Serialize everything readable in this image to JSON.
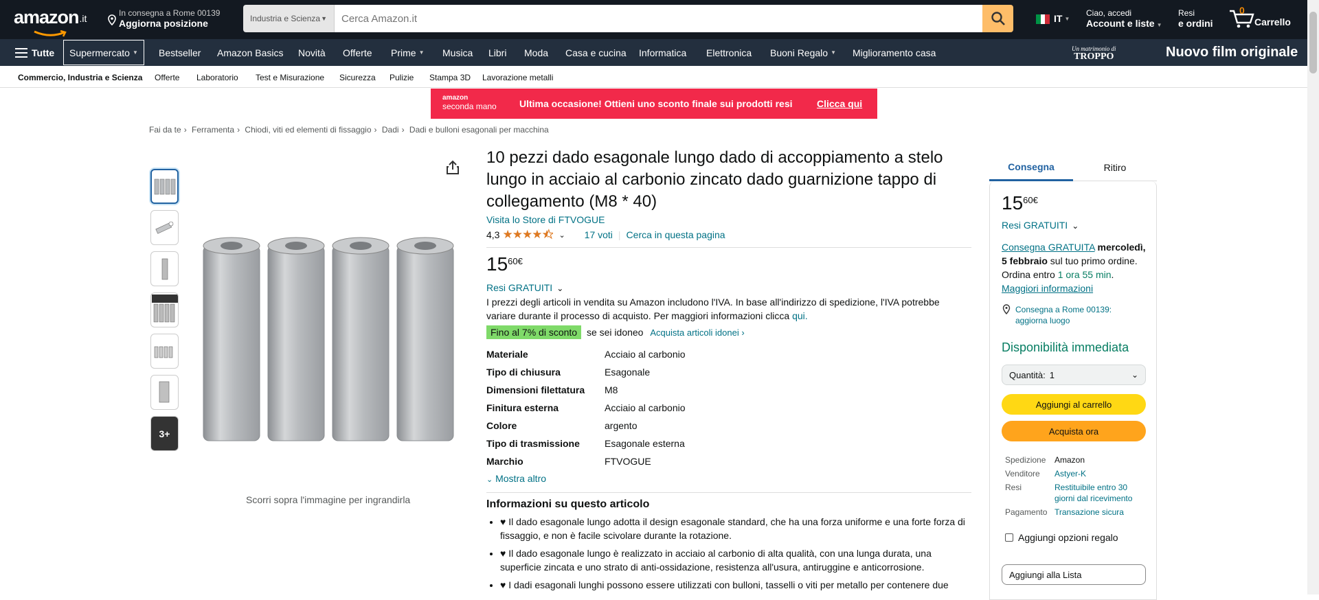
{
  "header": {
    "logo": "amazon",
    "logo_tld": ".it",
    "location_line1": "In consegna a Rome 00139",
    "location_line2": "Aggiorna posizione",
    "search_category": "Industria e Scienza",
    "search_placeholder": "Cerca Amazon.it",
    "language": "IT",
    "account_line1": "Ciao, accedi",
    "account_line2": "Account e liste",
    "orders_line1": "Resi",
    "orders_line2": "e ordini",
    "cart_count": "0",
    "cart_label": "Carrello"
  },
  "nav": {
    "all": "Tutte",
    "items": [
      "Supermercato",
      "Bestseller",
      "Amazon Basics",
      "Novità",
      "Offerte",
      "Prime",
      "Musica",
      "Libri",
      "Moda",
      "Casa e cucina",
      "Informatica",
      "Elettronica",
      "Buoni Regalo",
      "Miglioramento casa"
    ],
    "promo_small_1": "Un matrimonio di",
    "promo_small_2": "TROPPO",
    "promo_big": "Nuovo film originale"
  },
  "subnav": [
    "Commercio, Industria e Scienza",
    "Offerte",
    "Laboratorio",
    "Test e Misurazione",
    "Sicurezza",
    "Pulizie",
    "Stampa 3D",
    "Lavorazione metalli"
  ],
  "banner": {
    "logo1": "amazon",
    "logo2": "seconda mano",
    "text": "Ultima occasione! Ottieni uno sconto finale sui prodotti resi",
    "link": "Clicca qui"
  },
  "breadcrumbs": [
    "Fai da te",
    "Ferramenta",
    "Chiodi, viti ed elementi di fissaggio",
    "Dadi",
    "Dadi e bulloni esagonali per macchina"
  ],
  "gallery": {
    "more_thumbs": "3+",
    "zoom_hint": "Scorri sopra l'immagine per ingrandirla"
  },
  "product": {
    "title": "10 pezzi dado esagonale lungo dado di accoppiamento a stelo lungo in acciaio al carbonio zincato dado guarnizione tappo di collegamento (M8 * 40)",
    "store_link": "Visita lo Store di FTVOGUE",
    "rating": "4,3",
    "rating_value": 4.3,
    "votes": "17 voti",
    "search_page": "Cerca in questa pagina",
    "price_int": "15",
    "price_dec": "60",
    "currency": "€",
    "returns": "Resi GRATUITI",
    "vat_text": "I prezzi degli articoli in vendita su Amazon includono l'IVA. In base all'indirizzo di spedizione, l'IVA potrebbe variare durante il processo di acquisto. Per maggiori informazioni clicca",
    "vat_link": "qui.",
    "deal_badge": "Fino al 7% di sconto",
    "deal_text": "se sei idoneo",
    "deal_link": "Acquista articoli idonei ›",
    "show_more": "Mostra altro",
    "specs": [
      {
        "k": "Materiale",
        "v": "Acciaio al carbonio"
      },
      {
        "k": "Tipo di chiusura",
        "v": "Esagonale"
      },
      {
        "k": "Dimensioni filettatura",
        "v": "M8"
      },
      {
        "k": "Finitura esterna",
        "v": "Acciaio al carbonio"
      },
      {
        "k": "Colore",
        "v": "argento"
      },
      {
        "k": "Tipo di trasmissione",
        "v": "Esagonale esterna"
      },
      {
        "k": "Marchio",
        "v": "FTVOGUE"
      }
    ],
    "about_title": "Informazioni su questo articolo",
    "about": [
      "♥ Il dado esagonale lungo adotta il design esagonale standard, che ha una forza uniforme e una forte forza di fissaggio, e non è facile scivolare durante la rotazione.",
      "♥ Il dado esagonale lungo è realizzato in acciaio al carbonio di alta qualità, con una lunga durata, una superficie zincata e uno strato di anti-ossidazione, resistenza all'usura, antiruggine e anticorrosione.",
      "♥ I dadi esagonali lunghi possono essere utilizzati con bulloni, tasselli o viti per metallo per contenere due"
    ]
  },
  "buybox": {
    "tab_delivery": "Consegna",
    "tab_pickup": "Ritiro",
    "price_int": "15",
    "price_dec": "60",
    "currency": "€",
    "returns": "Resi GRATUITI",
    "delivery_link": "Consegna GRATUITA",
    "delivery_day": "mercoledì, 5 febbraio",
    "delivery_rest": "sul tuo primo ordine.",
    "order_within": "Ordina entro",
    "order_time": "1 ora 55 min",
    "more_info": "Maggiori informazioni",
    "deliver_to": "Consegna a Rome 00139: aggiorna luogo",
    "availability": "Disponibilità immediata",
    "qty_label": "Quantità:",
    "qty_value": "1",
    "add_to_cart": "Aggiungi al carrello",
    "buy_now": "Acquista ora",
    "rows": [
      {
        "k": "Spedizione",
        "v": "Amazon"
      },
      {
        "k": "Venditore",
        "v": "Astyer-K"
      },
      {
        "k": "Resi",
        "v": "Restituibile entro 30 giorni dal ricevimento"
      },
      {
        "k": "Pagamento",
        "v": "Transazione sicura"
      }
    ],
    "gift": "Aggiungi opzioni regalo",
    "add_list": "Aggiungi alla Lista"
  }
}
